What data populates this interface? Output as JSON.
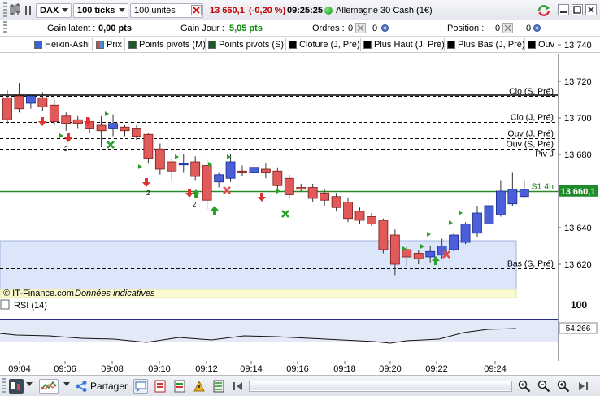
{
  "toolbar": {
    "instrument": "DAX",
    "period": "100 ticks",
    "units": "100 unités",
    "price": "13 660,1",
    "change": "(-0,20 %)",
    "time": "09:25:25",
    "market_name": "Allemagne 30 Cash (1€)"
  },
  "positions": {
    "latent_label": "Gain latent :",
    "latent_value": "0,00 pts",
    "day_label": "Gain Jour :",
    "day_value": "5,05 pts",
    "orders_label": "Ordres :",
    "orders_value": "0",
    "orders_value2": "0",
    "position_label": "Position :",
    "position_value": "0",
    "position_value2": "0"
  },
  "indicators": [
    {
      "label": "Heikin-Ashi",
      "color": "#3a63d6"
    },
    {
      "label": "Prix",
      "color": "#4a8fd0"
    },
    {
      "label": "Points pivots (M)",
      "color": "#1a5a2a"
    },
    {
      "label": "Points pivots (S)",
      "color": "#1a5a2a"
    },
    {
      "label": "Clôture (J, Pré)",
      "color": "#000000"
    },
    {
      "label": "Plus Haut (J, Pré)",
      "color": "#000000"
    },
    {
      "label": "Plus Bas (J, Pré)",
      "color": "#000000"
    },
    {
      "label": "Ouv",
      "color": "#000000"
    }
  ],
  "chart_data": {
    "type": "candlestick",
    "style": "heikin-ashi",
    "ylim": [
      13608,
      13745
    ],
    "y_ticks": [
      "13 740",
      "13 720",
      "13 700",
      "13 680",
      "13 660",
      "13 640",
      "13 620"
    ],
    "x_ticks": [
      "09:04",
      "09:06",
      "09:08",
      "09:10",
      "09:12",
      "09:14",
      "09:16",
      "09:18",
      "09:20",
      "09:22",
      "09:24"
    ],
    "candles": [
      {
        "o": 13711,
        "c": 13699,
        "h": 13715,
        "l": 13697
      },
      {
        "o": 13712,
        "c": 13705,
        "h": 13719,
        "l": 13703
      },
      {
        "o": 13708,
        "c": 13712,
        "h": 13713,
        "l": 13705
      },
      {
        "o": 13711,
        "c": 13706,
        "h": 13714,
        "l": 13704
      },
      {
        "o": 13707,
        "c": 13698,
        "h": 13710,
        "l": 13696
      },
      {
        "o": 13701,
        "c": 13697,
        "h": 13703,
        "l": 13693
      },
      {
        "o": 13699,
        "c": 13697,
        "h": 13701,
        "l": 13694
      },
      {
        "o": 13698,
        "c": 13694,
        "h": 13700,
        "l": 13692
      },
      {
        "o": 13696,
        "c": 13693,
        "h": 13701,
        "l": 13684
      },
      {
        "o": 13694,
        "c": 13697,
        "h": 13702,
        "l": 13690
      },
      {
        "o": 13695,
        "c": 13693,
        "h": 13696,
        "l": 13690
      },
      {
        "o": 13694,
        "c": 13690,
        "h": 13696,
        "l": 13688
      },
      {
        "o": 13691,
        "c": 13678,
        "h": 13692,
        "l": 13675
      },
      {
        "o": 13683,
        "c": 13672,
        "h": 13686,
        "l": 13669
      },
      {
        "o": 13676,
        "c": 13671,
        "h": 13678,
        "l": 13666
      },
      {
        "o": 13675,
        "c": 13675,
        "h": 13680,
        "l": 13670
      },
      {
        "o": 13676,
        "c": 13668,
        "h": 13679,
        "l": 13666
      },
      {
        "o": 13674,
        "c": 13655,
        "h": 13677,
        "l": 13650
      },
      {
        "o": 13665,
        "c": 13669,
        "h": 13670,
        "l": 13662
      },
      {
        "o": 13667,
        "c": 13676,
        "h": 13680,
        "l": 13665
      },
      {
        "o": 13671,
        "c": 13670,
        "h": 13674,
        "l": 13668
      },
      {
        "o": 13670,
        "c": 13673,
        "h": 13675,
        "l": 13668
      },
      {
        "o": 13672,
        "c": 13670,
        "h": 13675,
        "l": 13667
      },
      {
        "o": 13671,
        "c": 13663,
        "h": 13673,
        "l": 13661
      },
      {
        "o": 13667,
        "c": 13658,
        "h": 13669,
        "l": 13656
      },
      {
        "o": 13662,
        "c": 13661,
        "h": 13664,
        "l": 13660
      },
      {
        "o": 13662,
        "c": 13656,
        "h": 13664,
        "l": 13654
      },
      {
        "o": 13659,
        "c": 13655,
        "h": 13661,
        "l": 13652
      },
      {
        "o": 13657,
        "c": 13651,
        "h": 13659,
        "l": 13649
      },
      {
        "o": 13654,
        "c": 13645,
        "h": 13656,
        "l": 13643
      },
      {
        "o": 13649,
        "c": 13644,
        "h": 13651,
        "l": 13642
      },
      {
        "o": 13646,
        "c": 13642,
        "h": 13648,
        "l": 13641
      },
      {
        "o": 13644,
        "c": 13628,
        "h": 13645,
        "l": 13626
      },
      {
        "o": 13636,
        "c": 13620,
        "h": 13639,
        "l": 13614
      },
      {
        "o": 13628,
        "c": 13624,
        "h": 13630,
        "l": 13619
      },
      {
        "o": 13626,
        "c": 13623,
        "h": 13628,
        "l": 13620
      },
      {
        "o": 13624,
        "c": 13627,
        "h": 13630,
        "l": 13621
      },
      {
        "o": 13625,
        "c": 13630,
        "h": 13634,
        "l": 13623
      },
      {
        "o": 13628,
        "c": 13636,
        "h": 13637,
        "l": 13627
      },
      {
        "o": 13632,
        "c": 13642,
        "h": 13643,
        "l": 13631
      },
      {
        "o": 13637,
        "c": 13648,
        "h": 13652,
        "l": 13635
      },
      {
        "o": 13642,
        "c": 13652,
        "h": 13657,
        "l": 13641
      },
      {
        "o": 13647,
        "c": 13660,
        "h": 13666,
        "l": 13646
      },
      {
        "o": 13653,
        "c": 13661,
        "h": 13670,
        "l": 13652
      },
      {
        "o": 13657,
        "c": 13661,
        "h": 13666,
        "l": 13656
      }
    ],
    "levels": [
      {
        "label": "Clo (S, Pré)",
        "value": 13712,
        "style": "dashed"
      },
      {
        "label": "Clo (J, Pré)",
        "value": 13698,
        "style": "dashed"
      },
      {
        "label": "Ouv (J, Pré)",
        "value": 13689,
        "style": "dashed"
      },
      {
        "label": "Ouv (S, Pré)",
        "value": 13683,
        "style": "dashed"
      },
      {
        "label": "Piv J",
        "value": 13678,
        "style": "solid"
      },
      {
        "label": "S1 4h",
        "value": 13660,
        "style": "solid-green"
      },
      {
        "label": "Bas (S, Pré)",
        "value": 13618,
        "style": "dashed"
      }
    ],
    "price_tag": "13 660,1",
    "rsi": {
      "label": "RSI (14)",
      "value_tag": "54,266",
      "top_level": "100"
    }
  },
  "watermark": {
    "source": "© IT-Finance.com",
    "note": "Données indicatives"
  },
  "bottom": {
    "share_label": "Partager"
  }
}
